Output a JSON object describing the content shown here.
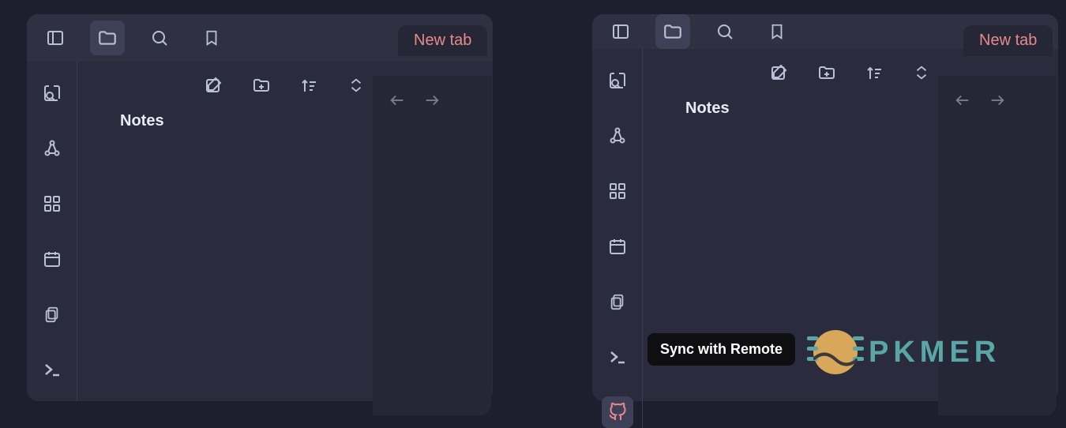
{
  "tab": {
    "label": "New tab"
  },
  "pane": {
    "title": "Notes"
  },
  "tooltip": {
    "sync": "Sync with Remote"
  },
  "watermark": {
    "text": "PKMER"
  },
  "colors": {
    "accent_red": "#e78a8a",
    "icon": "#b9bfd6",
    "bg_window": "#2a2b3c",
    "bg_outer": "#1e1e2e"
  }
}
